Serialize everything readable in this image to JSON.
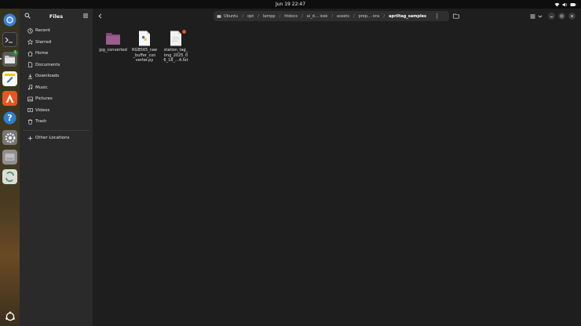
{
  "topbar": {
    "clock": "Jun 19  22:47"
  },
  "sidebar": {
    "title": "Files",
    "places": [
      {
        "label": "Recent",
        "icon": "clock-icon"
      },
      {
        "label": "Starred",
        "icon": "star-icon"
      },
      {
        "label": "Home",
        "icon": "home-icon"
      },
      {
        "label": "Documents",
        "icon": "document-icon"
      },
      {
        "label": "Downloads",
        "icon": "download-icon"
      },
      {
        "label": "Music",
        "icon": "music-icon"
      },
      {
        "label": "Pictures",
        "icon": "picture-icon"
      },
      {
        "label": "Videos",
        "icon": "video-icon"
      },
      {
        "label": "Trash",
        "icon": "trash-icon"
      }
    ],
    "other_locations": "Other Locations"
  },
  "path": {
    "crumbs": [
      "Ubuntu",
      "opt",
      "lampp",
      "htdocs",
      "ai_d… iosk",
      "assets",
      "prep… ons",
      "apriltag_samples"
    ]
  },
  "files": [
    {
      "name": "jpg_converted",
      "type": "folder"
    },
    {
      "name": "RGB565_raw_buffer_converter.py",
      "display": "RGB565_raw\n_buffer_con\nverter.py",
      "type": "python"
    },
    {
      "name": "station_tag_img_2025_06_18_…4.txt",
      "display": "station_tag_\nimg_2025_0\n6_18_…4.txt",
      "type": "text"
    }
  ],
  "dock": {
    "badge": "1",
    "apps": [
      "chromium-icon",
      "terminal-icon",
      "files-icon",
      "text-editor-icon",
      "app-center-icon",
      "help-icon",
      "settings-icon",
      "disk-icon",
      "trash-recycle-icon",
      "show-apps-icon"
    ]
  },
  "colors": {
    "folder": "#9b5c8e",
    "accent": "#e95420"
  }
}
